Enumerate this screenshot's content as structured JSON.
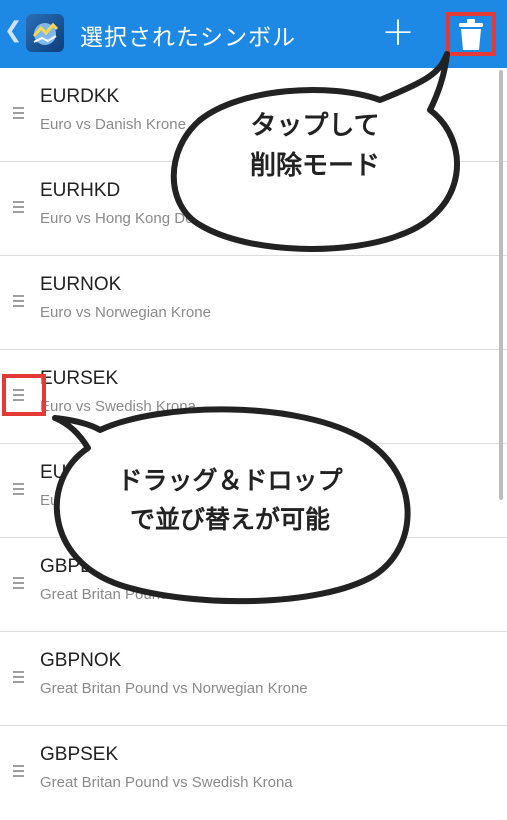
{
  "header": {
    "back_glyph": "❮",
    "title": "選択されたシンボル",
    "add_glyph": "+",
    "icons": [
      "back-icon",
      "mt-app-icon",
      "add-icon",
      "trash-icon"
    ],
    "bg_color": "#1e88e5"
  },
  "symbols": [
    {
      "symbol": "EURDKK",
      "description": "Euro vs Danish Krone"
    },
    {
      "symbol": "EURHKD",
      "description": "Euro vs Hong Kong Dollar"
    },
    {
      "symbol": "EURNOK",
      "description": "Euro vs Norwegian Krone"
    },
    {
      "symbol": "EURSEK",
      "description": "Euro vs Swedish Krona"
    },
    {
      "symbol": "EURUSD",
      "description": "Euro vs US Dollar"
    },
    {
      "symbol": "GBPDKK",
      "description": "Great Britan Pound vs Danish Krone"
    },
    {
      "symbol": "GBPNOK",
      "description": "Great Britan Pound vs Norwegian Krone"
    },
    {
      "symbol": "GBPSEK",
      "description": "Great Britan Pound vs Swedish Krona"
    }
  ],
  "annotations": {
    "trash_bubble": [
      "タップして",
      "削除モード"
    ],
    "drag_bubble": [
      "ドラッグ＆ドロップ",
      "で並び替えが可能"
    ],
    "highlight_color": "#e53935"
  }
}
